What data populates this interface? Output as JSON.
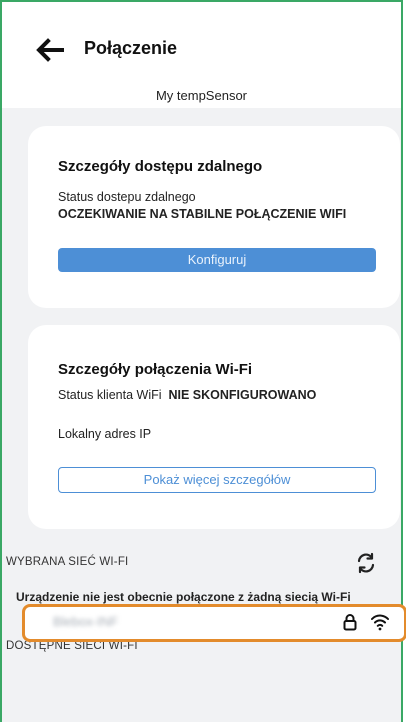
{
  "header": {
    "title": "Połączenie"
  },
  "device": {
    "name": "My tempSensor"
  },
  "remote_access": {
    "title": "Szczegóły dostępu zdalnego",
    "status_label": "Status dostepu zdalnego",
    "status_value": "OCZEKIWANIE NA STABILNE POŁĄCZENIE WIFI",
    "configure_button": "Konfiguruj"
  },
  "wifi_details": {
    "title": "Szczegóły połączenia Wi-Fi",
    "client_status_label": "Status klienta WiFi",
    "client_status_value": "NIE SKONFIGUROWANO",
    "local_ip_label": "Lokalny adres IP",
    "more_details_button": "Pokaż więcej szczegółów"
  },
  "selected_network": {
    "section_title": "WYBRANA SIEĆ WI-FI",
    "message": "Urządzenie nie jest obecnie połączone z żadną siecią Wi-Fi"
  },
  "available_networks": {
    "section_title": "DOSTĘPNE SIECI WI-FI",
    "networks": [
      {
        "name": "Blebox-INF",
        "secured": true
      }
    ]
  },
  "colors": {
    "accent_blue": "#4d8fd6",
    "frame_green": "#3aa865",
    "highlight_orange": "#e38b2c",
    "background": "#f1f2f4"
  },
  "icons": [
    "back-arrow-icon",
    "refresh-icon",
    "lock-icon",
    "wifi-icon"
  ]
}
